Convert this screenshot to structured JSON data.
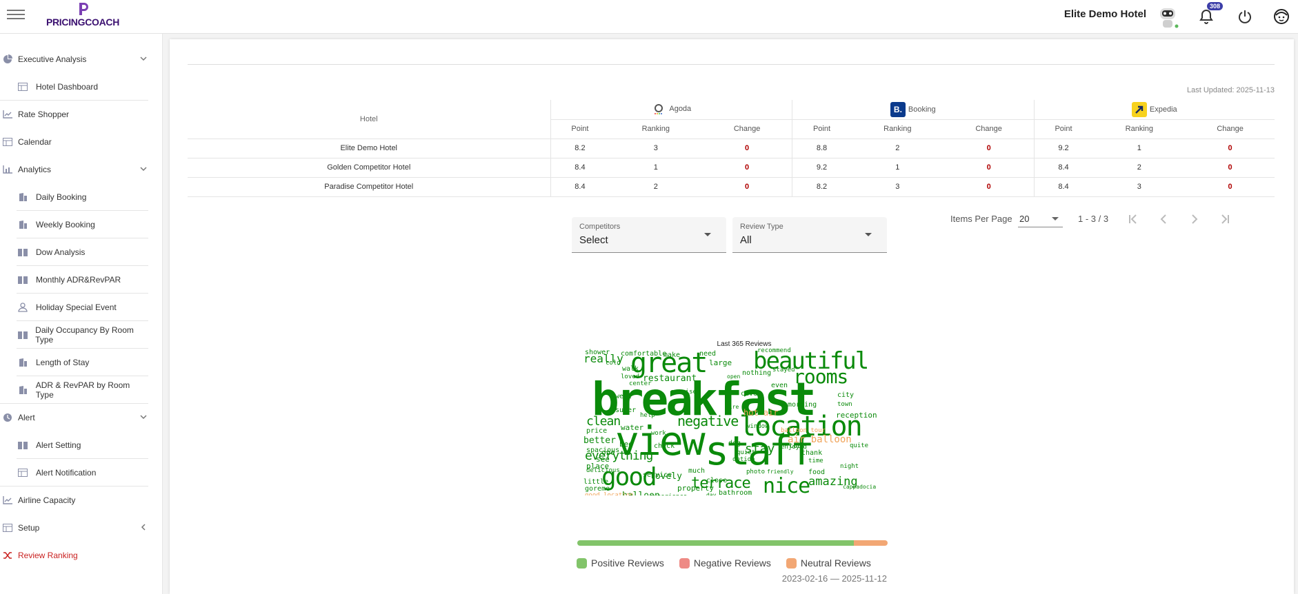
{
  "header": {
    "brand": "PRICINGCOACH",
    "hotel_name": "Elite Demo Hotel",
    "notification_count": "308"
  },
  "sidebar": {
    "items": [
      {
        "label": "Executive Analysis",
        "icon": "pie-chart-icon"
      },
      {
        "label": "Hotel Dashboard",
        "icon": "table-icon"
      },
      {
        "label": "Rate Shopper",
        "icon": "line-chart-icon"
      },
      {
        "label": "Calendar",
        "icon": "table-icon"
      },
      {
        "label": "Analytics",
        "icon": "bar-chart-icon"
      },
      {
        "label": "Daily Booking",
        "icon": "building-icon"
      },
      {
        "label": "Weekly Booking",
        "icon": "building-icon"
      },
      {
        "label": "Dow Analysis",
        "icon": "book-icon"
      },
      {
        "label": "Monthly ADR&RevPAR",
        "icon": "book-icon"
      },
      {
        "label": "Holiday Special Event",
        "icon": "person-icon"
      },
      {
        "label": "Daily Occupancy By Room Type",
        "icon": "book-icon"
      },
      {
        "label": "Length of Stay",
        "icon": "building-icon"
      },
      {
        "label": "ADR & RevPAR by Room Type",
        "icon": "building-icon"
      },
      {
        "label": "Alert",
        "icon": "clock-icon"
      },
      {
        "label": "Alert Setting",
        "icon": "book-icon"
      },
      {
        "label": "Alert Notification",
        "icon": "table-icon"
      },
      {
        "label": "Airline Capacity",
        "icon": "line-chart-icon"
      },
      {
        "label": "Setup",
        "icon": "table-icon"
      },
      {
        "label": "Review Ranking",
        "icon": "shuffle-icon"
      }
    ]
  },
  "ranking": {
    "last_updated": "Last Updated: 2025-11-13",
    "hotel_header": "Hotel",
    "otas": [
      {
        "name": "Agoda"
      },
      {
        "name": "Booking"
      },
      {
        "name": "Expedia"
      }
    ],
    "sub_headers": {
      "point": "Point",
      "ranking": "Ranking",
      "change": "Change"
    },
    "rows": [
      {
        "hotel": "Elite Demo Hotel",
        "values": [
          "8.2",
          "3",
          "0",
          "8.8",
          "2",
          "0",
          "9.2",
          "1",
          "0"
        ]
      },
      {
        "hotel": "Golden Competitor Hotel",
        "values": [
          "8.4",
          "1",
          "0",
          "9.2",
          "1",
          "0",
          "8.4",
          "2",
          "0"
        ]
      },
      {
        "hotel": "Paradise Competitor Hotel",
        "values": [
          "8.4",
          "2",
          "0",
          "8.2",
          "3",
          "0",
          "8.4",
          "3",
          "0"
        ]
      }
    ]
  },
  "paginator": {
    "items_per_page_label": "Items Per Page",
    "items_per_page": "20",
    "range": "1 - 3 / 3"
  },
  "filters": {
    "competitors": {
      "label": "Competitors",
      "value": "Select"
    },
    "review_type": {
      "label": "Review Type",
      "value": "All"
    }
  },
  "wordcloud": {
    "title": "Last 365 Reviews"
  },
  "sentiment": {
    "positive_fraction": 0.89,
    "negative_fraction": 0.0,
    "neutral_fraction": 0.11,
    "legend": [
      "Positive Reviews",
      "Negative Reviews",
      "Neutral Reviews"
    ],
    "colors": {
      "positive": "#82c46a",
      "negative": "#ee8a85",
      "neutral": "#f2a774"
    },
    "date_range": "2023-02-16 — 2025-11-12"
  }
}
